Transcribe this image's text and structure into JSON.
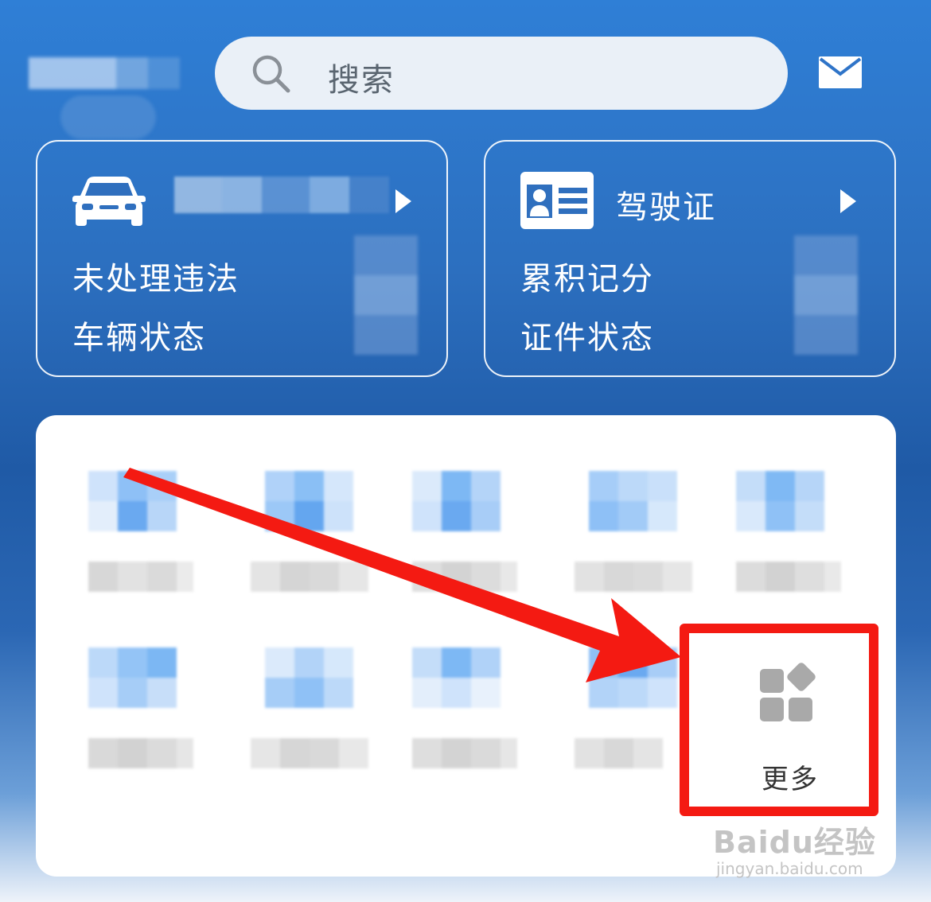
{
  "header": {
    "search_placeholder": "搜索",
    "icons": {
      "search": "search-icon",
      "mail": "mail-icon"
    }
  },
  "vehicle_card": {
    "line1": "未处理违法",
    "line2": "车辆状态",
    "icon": "car-icon"
  },
  "license_card": {
    "title": "驾驶证",
    "line1": "累积记分",
    "line2": "证件状态",
    "icon": "id-card-icon"
  },
  "services": {
    "more_label": "更多",
    "more_icon": "grid-more-icon"
  },
  "annotation": {
    "arrow_color": "#f41a12",
    "highlight_color": "#f41a12"
  },
  "watermark": {
    "brand": "Baidu经验",
    "url": "jingyan.baidu.com"
  },
  "colors": {
    "brand_blue": "#2c6fbf",
    "card_border": "#ffffff",
    "panel_bg": "#ffffff"
  }
}
